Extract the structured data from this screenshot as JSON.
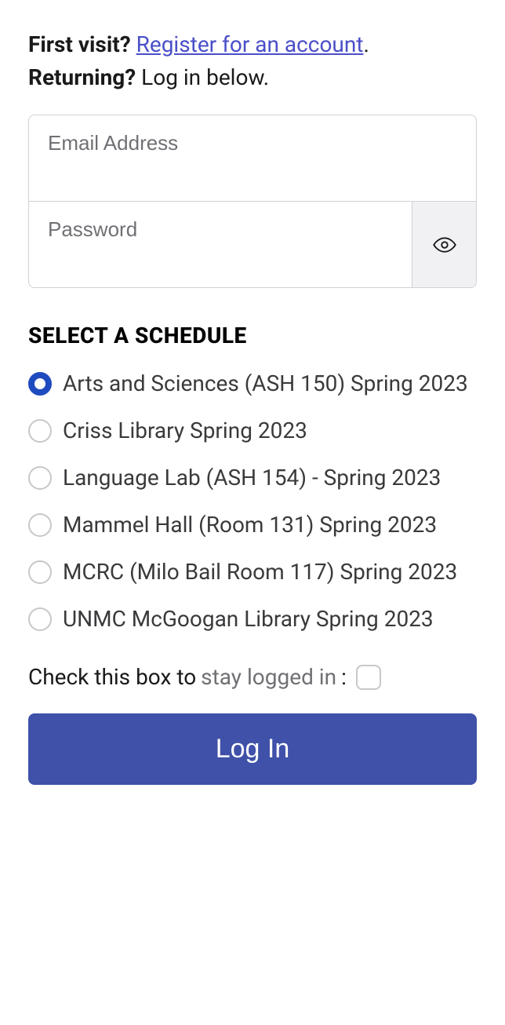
{
  "intro": {
    "first_visit_label": "First visit?",
    "register_link": "Register for an account",
    "period": ".",
    "returning_label": "Returning?",
    "login_below": "Log in below."
  },
  "fields": {
    "email_placeholder": "Email Address",
    "password_placeholder": "Password"
  },
  "schedule": {
    "header": "SELECT A SCHEDULE",
    "options": [
      {
        "label": "Arts and Sciences (ASH 150) Spring 2023",
        "selected": true
      },
      {
        "label": "Criss Library Spring 2023",
        "selected": false
      },
      {
        "label": "Language Lab (ASH 154) - Spring 2023",
        "selected": false
      },
      {
        "label": "Mammel Hall (Room 131) Spring 2023",
        "selected": false
      },
      {
        "label": "MCRC (Milo Bail Room 117) Spring 2023",
        "selected": false
      },
      {
        "label": "UNMC McGoogan Library Spring 2023",
        "selected": false
      }
    ]
  },
  "stay": {
    "prefix": "Check this box to ",
    "link_text": "stay logged in",
    "colon": ":"
  },
  "login_button": "Log In"
}
